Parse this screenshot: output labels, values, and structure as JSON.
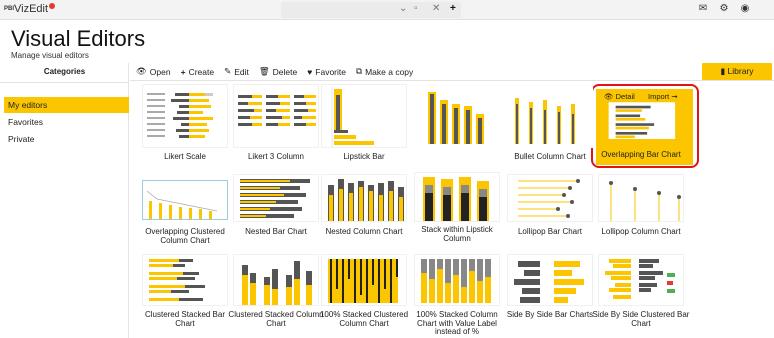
{
  "app": {
    "logo_prefix": "PBI",
    "logo_name": "VizEdit"
  },
  "topbar": {
    "icons": [
      "mail-icon",
      "gear-icon",
      "user-icon"
    ]
  },
  "page": {
    "title": "Visual Editors",
    "subtitle": "Manage visual editors"
  },
  "sidebar": {
    "heading": "Categories",
    "items": [
      {
        "label": "My editors",
        "active": true
      },
      {
        "label": "Favorites",
        "active": false
      },
      {
        "label": "Private",
        "active": false
      }
    ]
  },
  "toolbar": {
    "open": "Open",
    "create": "Create",
    "edit": "Edit",
    "delete": "Delete",
    "favorite": "Favorite",
    "copy": "Make a copy",
    "library": "Library"
  },
  "selected_overlay": {
    "detail": "Detail",
    "import": "Import"
  },
  "accent_color": "#fbc600",
  "highlight_color": "#e01414",
  "tiles": [
    {
      "label": "Likert Scale"
    },
    {
      "label": "Likert 3 Column"
    },
    {
      "label": "Lipstick Bar"
    },
    {
      "label": "Bullet Column Chart"
    },
    {
      "label": "Overlapping Bar Chart",
      "selected": true
    },
    {
      "label": "Overlapping Clustered Column Chart"
    },
    {
      "label": "Nested Bar Chart"
    },
    {
      "label": "Nested Column Chart"
    },
    {
      "label": "Stack within Lipstick Column"
    },
    {
      "label": "Lollipop Bar Chart"
    },
    {
      "label": "Lollipop Column Chart"
    },
    {
      "label": "Clustered Stacked Bar Chart"
    },
    {
      "label": "Clustered Stacked Column Chart"
    },
    {
      "label": "100% Stacked Clustered Column Chart"
    },
    {
      "label": "100% Stacked Column Chart with Value Label instead of %"
    },
    {
      "label": "Side By Side Bar Charts"
    },
    {
      "label": "Side By Side Clustered Bar Chart"
    }
  ]
}
